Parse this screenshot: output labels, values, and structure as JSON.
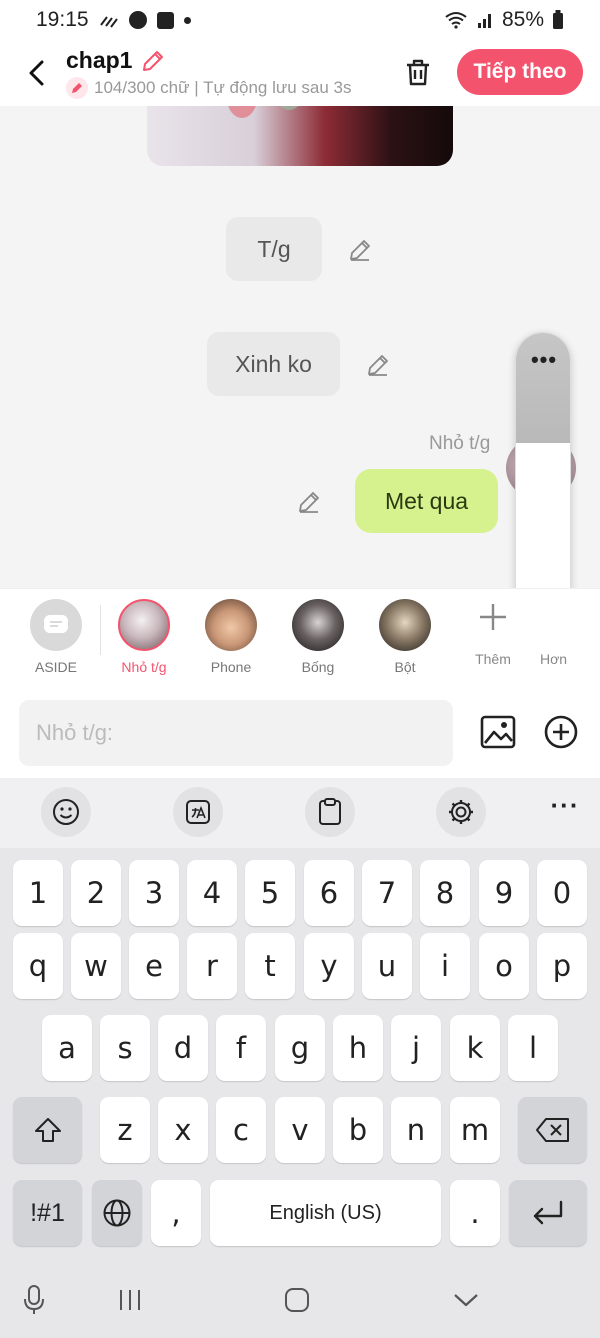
{
  "status_bar": {
    "time": "19:15",
    "battery": "85%"
  },
  "header": {
    "title": "chap1",
    "subtitle": "104/300 chữ | Tự động lưu sau 3s",
    "next_button": "Tiếp theo"
  },
  "chat": {
    "narrations": [
      "T/g",
      "Xinh ko"
    ],
    "speaker_name": "Nhỏ t/g",
    "user_message": "Met qua"
  },
  "float_panel": {
    "more": "•••"
  },
  "characters": [
    {
      "label": "ASIDE"
    },
    {
      "label": "Nhỏ t/g",
      "active": true
    },
    {
      "label": "Phone"
    },
    {
      "label": "Bống"
    },
    {
      "label": "Bột"
    }
  ],
  "add_character_label": "Thêm",
  "partial_label": "Hơn",
  "input": {
    "placeholder": "Nhỏ t/g:"
  },
  "keyboard": {
    "row_numbers": [
      "1",
      "2",
      "3",
      "4",
      "5",
      "6",
      "7",
      "8",
      "9",
      "0"
    ],
    "row1": [
      "q",
      "w",
      "e",
      "r",
      "t",
      "y",
      "u",
      "i",
      "o",
      "p"
    ],
    "row2": [
      "a",
      "s",
      "d",
      "f",
      "g",
      "h",
      "j",
      "k",
      "l"
    ],
    "row3": [
      "z",
      "x",
      "c",
      "v",
      "b",
      "n",
      "m"
    ],
    "symbols_key": "!#1",
    "comma_key": ",",
    "space_label": "English (US)",
    "period_key": ".",
    "toolbar_more": "···"
  },
  "colors": {
    "accent": "#f4536e",
    "user_bubble": "#d6f28e"
  }
}
